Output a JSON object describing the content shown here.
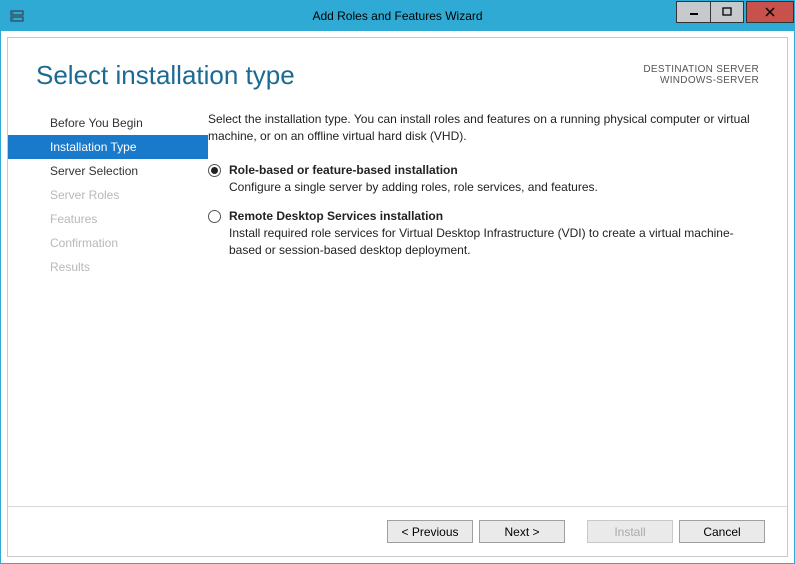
{
  "titlebar": {
    "title": "Add Roles and Features Wizard"
  },
  "header": {
    "page_title": "Select installation type",
    "dest_label": "DESTINATION SERVER",
    "dest_value": "WINDOWS-SERVER"
  },
  "sidebar": {
    "items": [
      {
        "label": "Before You Begin",
        "state": "normal"
      },
      {
        "label": "Installation Type",
        "state": "selected"
      },
      {
        "label": "Server Selection",
        "state": "normal"
      },
      {
        "label": "Server Roles",
        "state": "disabled"
      },
      {
        "label": "Features",
        "state": "disabled"
      },
      {
        "label": "Confirmation",
        "state": "disabled"
      },
      {
        "label": "Results",
        "state": "disabled"
      }
    ]
  },
  "main": {
    "intro": "Select the installation type. You can install roles and features on a running physical computer or virtual machine, or on an offline virtual hard disk (VHD).",
    "options": [
      {
        "title": "Role-based or feature-based installation",
        "desc": "Configure a single server by adding roles, role services, and features.",
        "selected": true
      },
      {
        "title": "Remote Desktop Services installation",
        "desc": "Install required role services for Virtual Desktop Infrastructure (VDI) to create a virtual machine-based or session-based desktop deployment.",
        "selected": false
      }
    ]
  },
  "buttons": {
    "previous": "< Previous",
    "next": "Next >",
    "install": "Install",
    "cancel": "Cancel"
  }
}
